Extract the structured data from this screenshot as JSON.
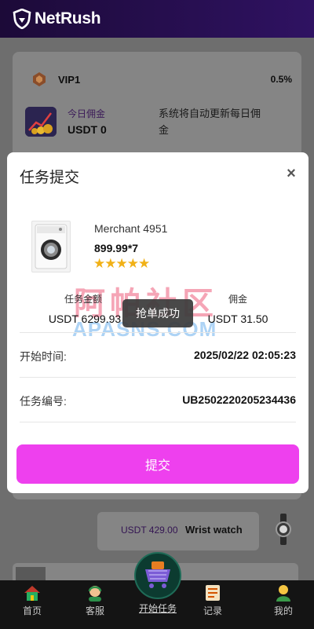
{
  "header": {
    "brand": "NetRush"
  },
  "vip": {
    "level": "VIP1",
    "rate": "0.5%"
  },
  "commission": {
    "label": "今日佣金",
    "value": "USDT 0",
    "note": "系统将自动更新每日佣金"
  },
  "background_orders": [
    {
      "amount": "USDT 429.00",
      "name": "Wrist watch"
    }
  ],
  "modal": {
    "title": "任务提交",
    "close": "×",
    "product": {
      "merchant": "Merchant 4951",
      "price": "899.99*7",
      "stars": "★★★★★",
      "rating": 5
    },
    "amount_label": "任务金额",
    "amount_value": "USDT 6299.93",
    "commission_label": "佣金",
    "commission_value": "USDT 31.50",
    "toast": "抢单成功",
    "start_time_label": "开始时间:",
    "start_time_value": "2025/02/22 02:05:23",
    "task_no_label": "任务编号:",
    "task_no_value": "UB2502220205234436",
    "submit_label": "提交"
  },
  "watermark": {
    "cn": "阿帕社区",
    "en": "APASNS.COM"
  },
  "nav": {
    "items": [
      {
        "label": "首页",
        "icon": "home-icon"
      },
      {
        "label": "客服",
        "icon": "support-icon"
      },
      {
        "label": "开始任务",
        "icon": "cart-icon"
      },
      {
        "label": "记录",
        "icon": "records-icon"
      },
      {
        "label": "我的",
        "icon": "profile-icon"
      }
    ]
  },
  "colors": {
    "accent": "#ee40ee",
    "header": "#2a1058",
    "nav": "#141414"
  }
}
